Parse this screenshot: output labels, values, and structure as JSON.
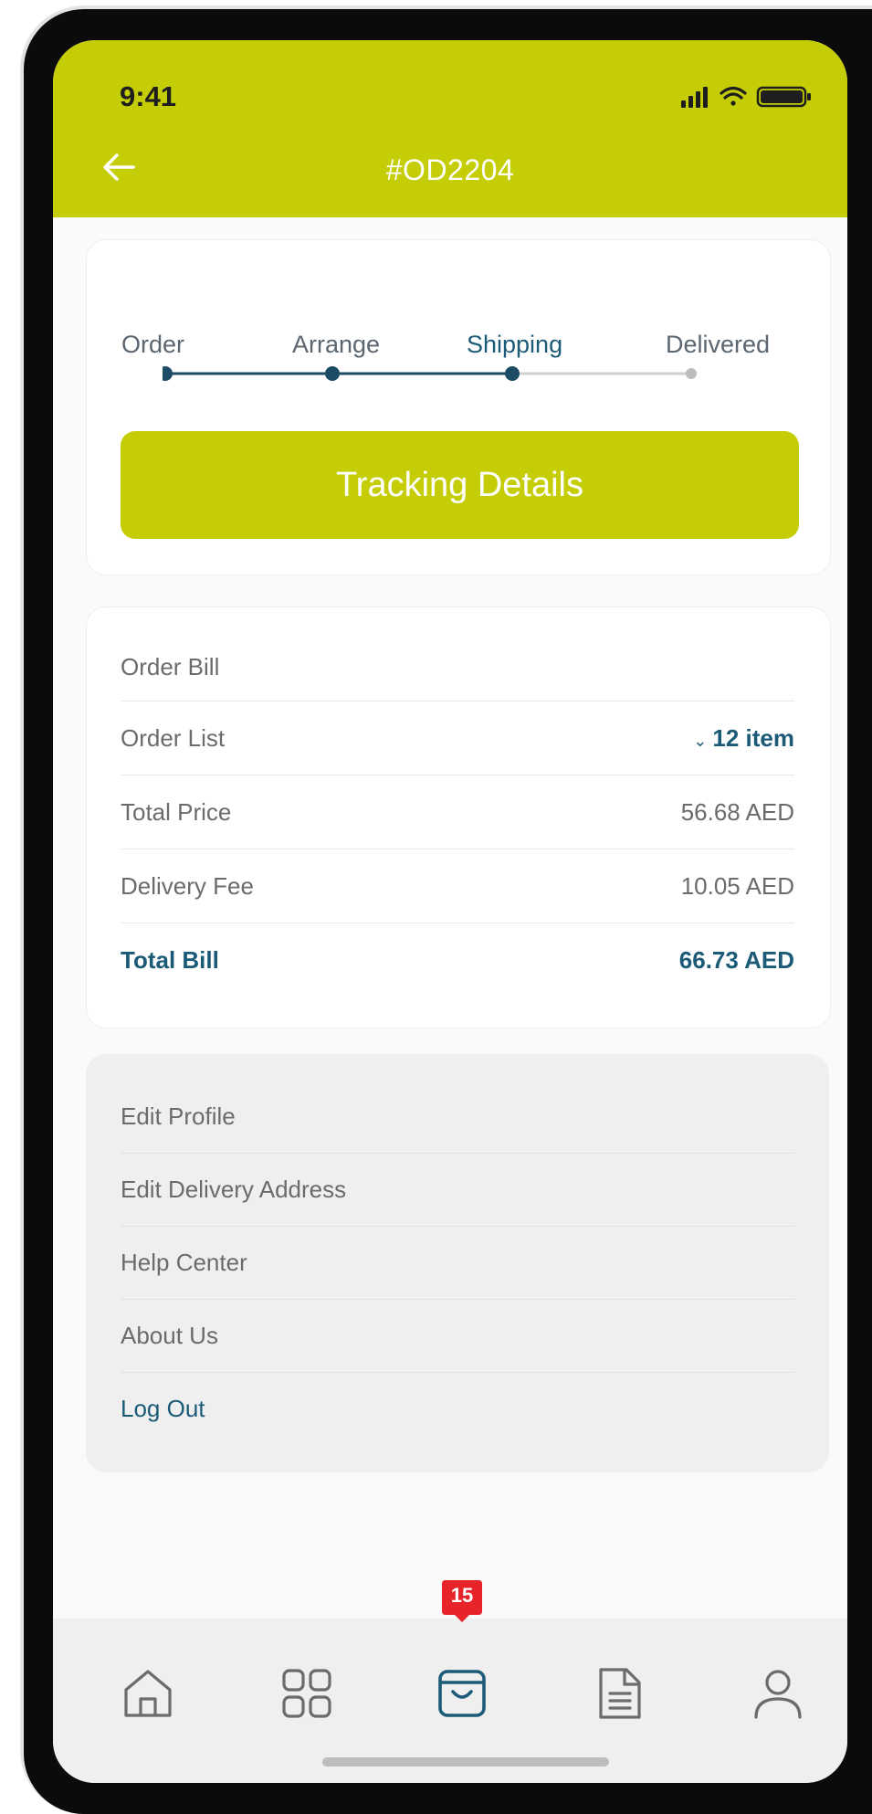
{
  "status_bar": {
    "time": "9:41"
  },
  "header": {
    "order_id": "#OD2204"
  },
  "progress": {
    "steps": [
      {
        "label": "Order",
        "state": "done"
      },
      {
        "label": "Arrange",
        "state": "done"
      },
      {
        "label": "Shipping",
        "state": "current"
      },
      {
        "label": "Delivered",
        "state": "pending"
      }
    ],
    "tracking_button": "Tracking Details"
  },
  "bill": {
    "heading": "Order Bill",
    "order_list_label": "Order List",
    "order_list_value": "12 item",
    "total_price_label": "Total Price",
    "total_price_value": "56.68 AED",
    "delivery_fee_label": "Delivery Fee",
    "delivery_fee_value": "10.05 AED",
    "total_bill_label": "Total Bill",
    "total_bill_value": "66.73 AED"
  },
  "menu": {
    "items": [
      "Edit Profile",
      "Edit Delivery Address",
      "Help Center",
      "About Us"
    ],
    "logout": "Log Out"
  },
  "tabbar": {
    "tabs": [
      "home-icon",
      "grid-icon",
      "bag-icon",
      "document-icon",
      "profile-icon"
    ],
    "active": "bag-icon",
    "cart_badge": "15"
  },
  "colors": {
    "accent": "#c5cd06",
    "primary_text": "#1c5b78",
    "muted_text": "#6b6b6b",
    "badge": "#e8242b"
  }
}
